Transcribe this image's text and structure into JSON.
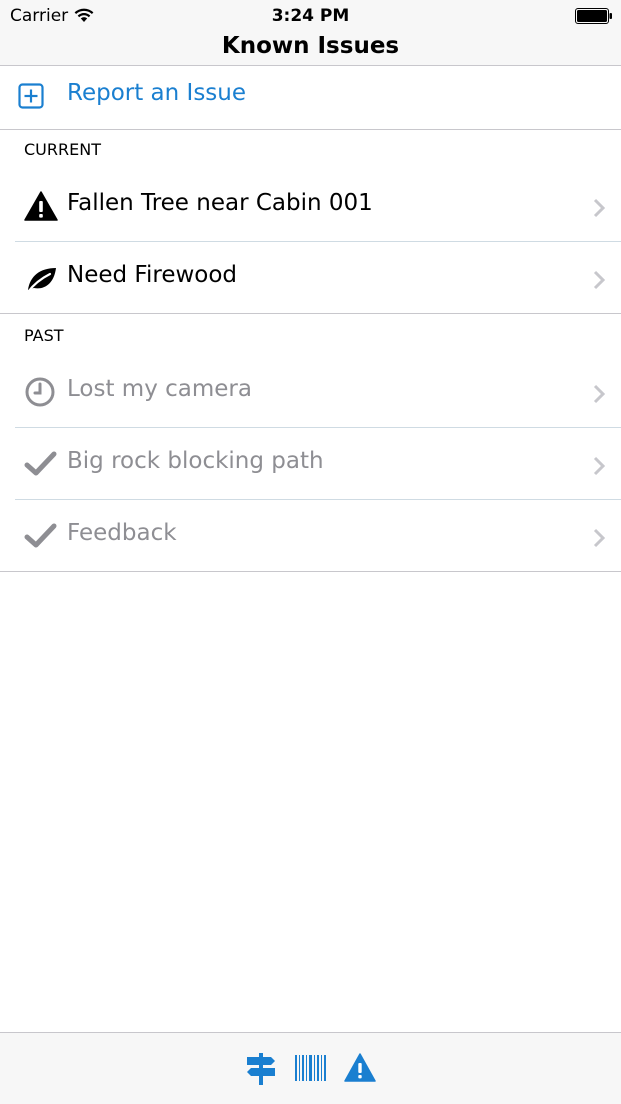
{
  "status_bar": {
    "carrier": "Carrier",
    "time": "3:24 PM"
  },
  "nav": {
    "title": "Known Issues"
  },
  "report": {
    "label": "Report an Issue",
    "icon": "plus-square-icon"
  },
  "sections": {
    "current": {
      "header": "CURRENT",
      "items": [
        {
          "label": "Fallen Tree near Cabin 001",
          "icon": "warning-icon"
        },
        {
          "label": "Need Firewood",
          "icon": "leaf-icon"
        }
      ]
    },
    "past": {
      "header": "PAST",
      "items": [
        {
          "label": "Lost my camera",
          "icon": "clock-icon"
        },
        {
          "label": "Big rock blocking path",
          "icon": "checkmark-icon"
        },
        {
          "label": "Feedback",
          "icon": "checkmark-icon"
        }
      ]
    }
  },
  "tabs": [
    {
      "icon": "signpost-icon"
    },
    {
      "icon": "barcode-icon"
    },
    {
      "icon": "warning-icon"
    }
  ],
  "colors": {
    "accent": "#1a7fd0",
    "past_text": "#8e8e93",
    "chevron": "#c7c7cc",
    "bar_background": "#f7f7f7"
  }
}
